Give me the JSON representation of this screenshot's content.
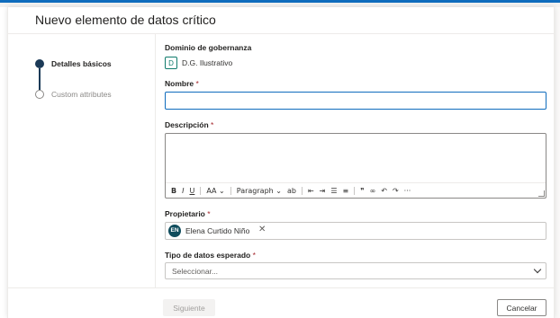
{
  "panel": {
    "title": "Nuevo elemento de datos crítico"
  },
  "steps": [
    {
      "label": "Detalles básicos",
      "active": true
    },
    {
      "label": "Custom attributes",
      "active": false
    }
  ],
  "domain": {
    "label": "Dominio de gobernanza",
    "chip": "D",
    "value": "D.G. Ilustrativo"
  },
  "name_field": {
    "label": "Nombre",
    "required_mark": "*",
    "value": ""
  },
  "description_field": {
    "label": "Descripción",
    "required_mark": "*",
    "toolbar": {
      "bold": "B",
      "italic": "I",
      "underline": "U",
      "font_size": "AA",
      "paragraph": "Paragraph",
      "more": "···"
    }
  },
  "owner_field": {
    "label": "Propietario",
    "required_mark": "*",
    "avatar_initials": "EN",
    "owner_name": "Elena Curtido Niño",
    "remove": "✕"
  },
  "datatype_field": {
    "label": "Tipo de datos esperado",
    "required_mark": "*",
    "placeholder": "Seleccionar..."
  },
  "footer": {
    "next_label": "Siguiente",
    "cancel_label": "Cancelar"
  },
  "colors": {
    "accent": "#0f6cbd",
    "step_active": "#1b3a57",
    "avatar": "#0f4c5c",
    "required": "#a4262c"
  }
}
